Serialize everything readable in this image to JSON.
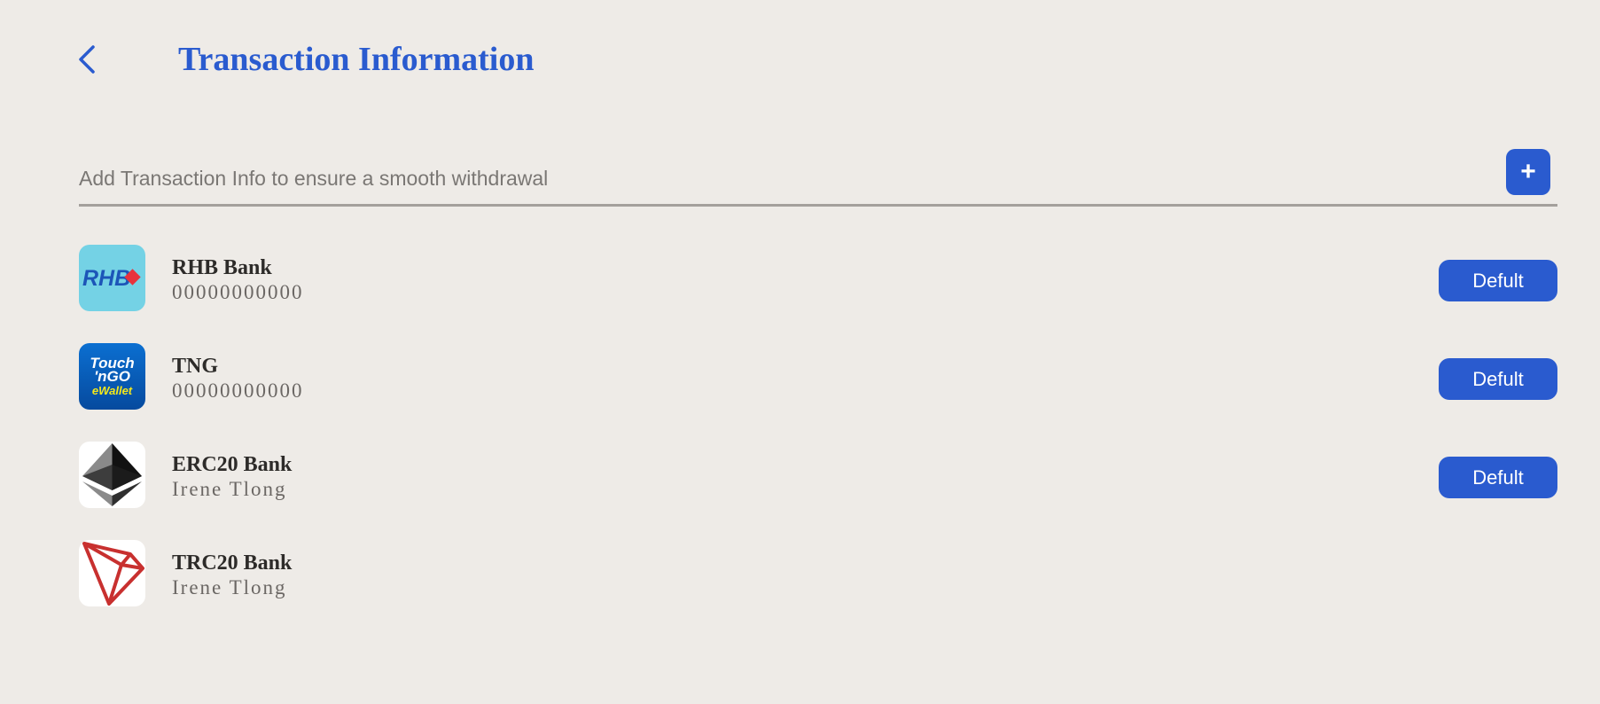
{
  "header": {
    "title": "Transaction Information",
    "back_icon": "chevron-left-icon"
  },
  "add_section": {
    "hint": "Add Transaction Info to ensure a smooth withdrawal",
    "add_label": "+"
  },
  "colors": {
    "accent": "#2a5bcf",
    "background": "#eeebe7"
  },
  "accounts": [
    {
      "name": "RHB Bank",
      "number": "00000000000",
      "logo": "rhb-logo",
      "logo_text": "RHB",
      "button": "Defult"
    },
    {
      "name": "TNG",
      "number": "00000000000",
      "logo": "touch-n-go-logo",
      "logo_text_1": "Touch",
      "logo_text_2": "'nGO",
      "logo_text_3": "eWallet",
      "button": "Defult"
    },
    {
      "name": "ERC20 Bank",
      "number": "Irene Tlong",
      "logo": "ethereum-logo",
      "button": "Defult"
    },
    {
      "name": "TRC20 Bank",
      "number": "Irene Tlong",
      "logo": "tron-logo"
    }
  ]
}
